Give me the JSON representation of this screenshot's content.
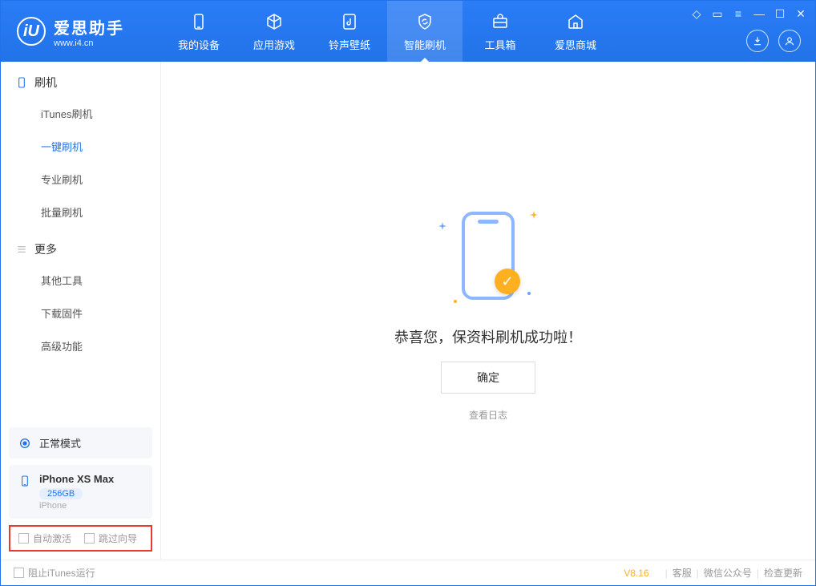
{
  "app": {
    "name": "爱思助手",
    "url": "www.i4.cn"
  },
  "nav": {
    "tabs": [
      {
        "label": "我的设备",
        "icon": "device"
      },
      {
        "label": "应用游戏",
        "icon": "cube"
      },
      {
        "label": "铃声壁纸",
        "icon": "music"
      },
      {
        "label": "智能刷机",
        "icon": "shield"
      },
      {
        "label": "工具箱",
        "icon": "toolbox"
      },
      {
        "label": "爱思商城",
        "icon": "home"
      }
    ],
    "active_index": 3
  },
  "sidebar": {
    "sections": [
      {
        "title": "刷机",
        "items": [
          "iTunes刷机",
          "一键刷机",
          "专业刷机",
          "批量刷机"
        ],
        "active_index": 1
      },
      {
        "title": "更多",
        "items": [
          "其他工具",
          "下载固件",
          "高级功能"
        ],
        "active_index": -1
      }
    ],
    "mode": {
      "label": "正常模式"
    },
    "device": {
      "name": "iPhone XS Max",
      "capacity": "256GB",
      "type": "iPhone"
    },
    "checks": {
      "auto_activate": "自动激活",
      "skip_guide": "跳过向导"
    }
  },
  "main": {
    "success_message": "恭喜您，保资料刷机成功啦！",
    "ok_label": "确定",
    "log_link": "查看日志"
  },
  "statusbar": {
    "block_itunes": "阻止iTunes运行",
    "version": "V8.16",
    "links": [
      "客服",
      "微信公众号",
      "检查更新"
    ]
  }
}
